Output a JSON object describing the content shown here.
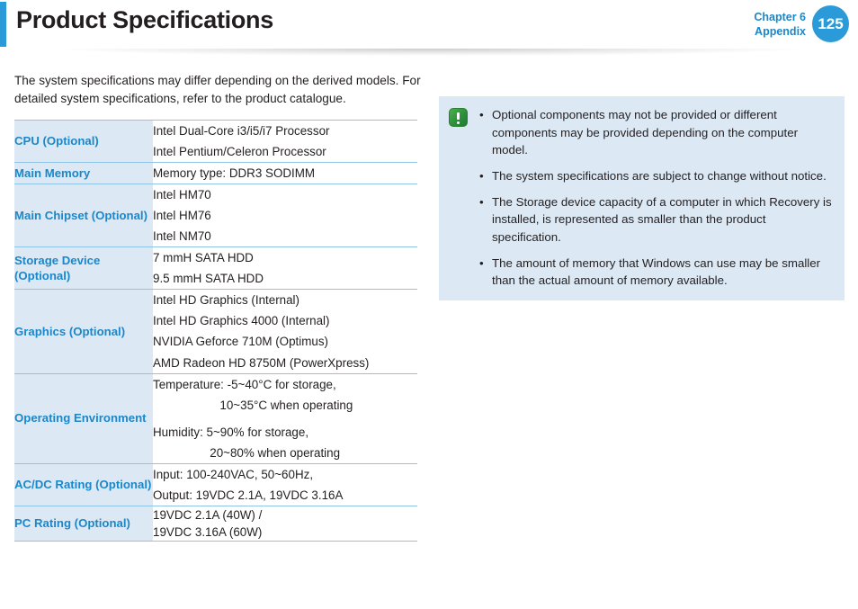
{
  "header": {
    "title": "Product Specifications",
    "chapter": "Chapter 6",
    "section": "Appendix",
    "page_number": "125",
    "accent_color": "#2a9bd8",
    "chapter_text_color": "#1b87c9"
  },
  "intro": {
    "line1": "The system specifications may differ depending on the derived models.",
    "line2": "For detailed system specifications, refer to the product catalogue."
  },
  "spec_table": {
    "label_bg_color": "#dce9f5",
    "label_text_color": "#1b87c9",
    "border_color": "#8fc4e8",
    "rows": [
      {
        "label": "CPU (Optional)",
        "values": [
          "Intel Dual-Core i3/i5/i7 Processor",
          "Intel Pentium/Celeron Processor"
        ]
      },
      {
        "label": "Main Memory",
        "values": [
          "Memory type: DDR3 SODIMM"
        ]
      },
      {
        "label": "Main Chipset (Optional)",
        "values": [
          "Intel HM70",
          "Intel HM76",
          "Intel NM70"
        ]
      },
      {
        "label": "Storage Device (Optional)",
        "values": [
          "7 mmH SATA HDD",
          "9.5 mmH SATA HDD"
        ]
      },
      {
        "label": "Graphics (Optional)",
        "values": [
          "Intel HD Graphics (Internal)",
          "Intel HD Graphics 4000 (Internal)",
          "NVIDIA Geforce 710M (Optimus)",
          "AMD Radeon HD 8750M (PowerXpress)"
        ]
      },
      {
        "label": "Operating Environment",
        "values": [
          "Temperature: -5~40°C for storage,",
          "                    10~35°C when operating",
          "Humidity: 5~90% for storage,",
          "                 20~80% when operating"
        ]
      },
      {
        "label": "AC/DC Rating (Optional)",
        "values": [
          "Input: 100-240VAC, 50~60Hz,",
          "Output: 19VDC 2.1A, 19VDC 3.16A"
        ]
      },
      {
        "label": "PC Rating (Optional)",
        "values": [
          "19VDC 2.1A (40W) /",
          "19VDC 3.16A (60W)"
        ]
      }
    ]
  },
  "note_box": {
    "background_color": "#dce9f5",
    "icon": "caution-exclamation-icon",
    "bullet_char": "•",
    "items": [
      "Optional components may not be provided or different components may be provided depending on the computer model.",
      "The system specifications are subject to change without notice.",
      "The Storage device capacity of a computer in which Recovery is installed, is represented as smaller than the product specification.",
      "The amount of memory that Windows can use may be smaller than the actual amount of memory available."
    ]
  }
}
